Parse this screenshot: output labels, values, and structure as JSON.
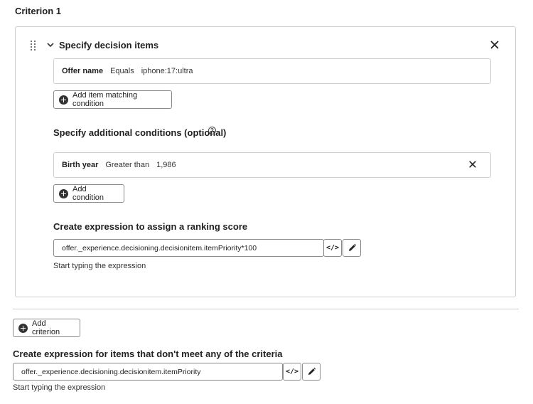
{
  "criterion": {
    "title": "Criterion 1",
    "decision_items": {
      "title": "Specify decision items",
      "condition": {
        "field": "Offer name",
        "operator": "Equals",
        "value": "iphone:17:ultra"
      },
      "add_button_label": "Add item matching condition"
    },
    "additional_conditions": {
      "title": "Specify additional conditions (optional)",
      "help_icon": "?",
      "condition": {
        "field": "Birth year",
        "operator": "Greater than",
        "value": "1,986"
      },
      "add_button_label": "Add condition"
    },
    "ranking": {
      "title": "Create expression to assign a ranking score",
      "expression": "offer._experience.decisioning.decisionitem.itemPriority*100",
      "helper": "Start typing the expression"
    }
  },
  "add_criterion_label": "Add criterion",
  "fallback": {
    "title": "Create expression for items that don't meet any of the criteria",
    "expression": "offer._experience.decisioning.decisionitem.itemPriority",
    "helper": "Start typing the expression"
  },
  "icons": {
    "drag": "drag-handle-icon",
    "chevron": "chevron-down-icon",
    "close": "close-icon",
    "add": "add-circle-icon",
    "code": "code-icon",
    "edit": "pencil-icon",
    "help": "help-icon"
  }
}
